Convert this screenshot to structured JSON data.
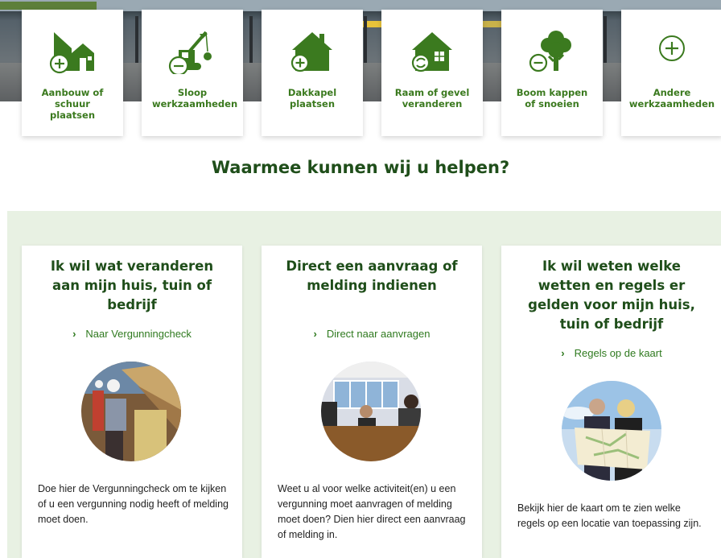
{
  "tiles": [
    {
      "label": "Aanbouw of schuur plaatsen",
      "icon": "house-extension-add-icon"
    },
    {
      "label": "Sloop werkzaamheden",
      "icon": "demolition-crane-icon"
    },
    {
      "label": "Dakkapel plaatsen",
      "icon": "house-dormer-add-icon"
    },
    {
      "label": "Raam of gevel veranderen",
      "icon": "house-window-change-icon"
    },
    {
      "label": "Boom kappen of snoeien",
      "icon": "tree-remove-icon"
    },
    {
      "label": "Andere werkzaamheden",
      "icon": "plus-circle-icon"
    }
  ],
  "heading": "Waarmee kunnen wij u helpen?",
  "cards": [
    {
      "title": "Ik wil wat veranderen aan mijn huis, tuin of bedrijf",
      "link": "Naar Vergunningcheck",
      "body": "Doe hier de Vergunningcheck om te kijken of u een vergunning nodig heeft of melding moet doen."
    },
    {
      "title": "Direct een aanvraag of melding indienen",
      "link": "Direct naar aanvragen",
      "body": "Weet u al voor welke activiteit(en) u een vergunning moet aanvragen of melding moet doen? Dien hier direct een aanvraag of melding in."
    },
    {
      "title": "Ik wil weten welke wetten en regels er gelden voor mijn huis, tuin of bedrijf",
      "link": "Regels op de kaart",
      "body": "Bekijk hier de kaart om te zien welke regels op een locatie van toepassing zijn."
    }
  ],
  "colors": {
    "brand_green": "#3b7a1f",
    "dark_green": "#1f4e1a",
    "panel_bg": "#e8f1e3"
  }
}
